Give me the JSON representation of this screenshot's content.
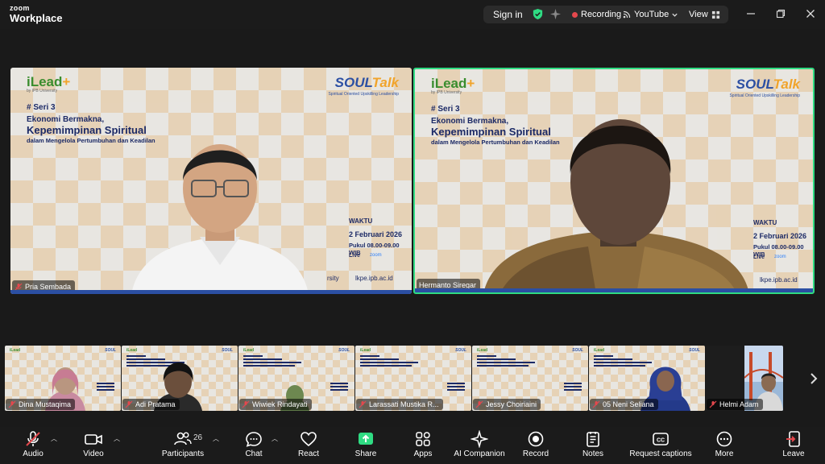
{
  "app": {
    "logo_top": "zoom",
    "logo_bottom": "Workplace"
  },
  "titlebar": {
    "signin": "Sign in",
    "recording": "Recording",
    "stream": "YouTube",
    "view": "View",
    "icons": [
      "shield-check-icon",
      "sparkle-icon",
      "recording-dot-icon",
      "broadcast-icon",
      "grid-icon",
      "minimize-icon",
      "restore-icon",
      "close-icon"
    ],
    "colors": {
      "shield": "#2fdc83",
      "recording": "#e5484d"
    }
  },
  "slide": {
    "brand_left": "iLead",
    "brand_left_plus": "+",
    "brand_left_sub": "by IPB University",
    "brand_right_a": "SOUL",
    "brand_right_b": "Talk",
    "brand_right_sub": "Spiritual Oriented Upskilling Leadership",
    "seri": "# Seri 3",
    "title1": "Ekonomi Bermakna,",
    "title2": "Kepemimpinan Spiritual",
    "title3": "dalam Mengelola Pertumbuhan dan Keadilan",
    "waktu": "WAKTU",
    "date": "2 Februari 2026",
    "pukul": "Pukul 08.00-09.00 WIB",
    "live": "Live",
    "zoom": "zoom",
    "site": "lkpe.ipb.ac.id",
    "univ": "rsity"
  },
  "main_tiles": [
    {
      "name": "Pria Sembada",
      "active": false
    },
    {
      "name": "Hermanto Siregar",
      "active": true
    }
  ],
  "thumbnails": [
    {
      "name": "Dina Mustaqima"
    },
    {
      "name": "Adi Pratama"
    },
    {
      "name": "Wiwiek Rindayati"
    },
    {
      "name": "Larassati Mustika R..."
    },
    {
      "name": "Jessy Choiriaini"
    },
    {
      "name": "05 Neni Seliana"
    },
    {
      "name": "Helmi Adam"
    }
  ],
  "toolbar": {
    "audio": "Audio",
    "video": "Video",
    "participants": "Participants",
    "participants_count": "26",
    "chat": "Chat",
    "react": "React",
    "share": "Share",
    "apps": "Apps",
    "ai": "AI Companion",
    "record": "Record",
    "notes": "Notes",
    "captions": "Request captions",
    "more": "More",
    "leave": "Leave",
    "colors": {
      "share": "#2fdc83",
      "leave": "#e5484d"
    }
  }
}
